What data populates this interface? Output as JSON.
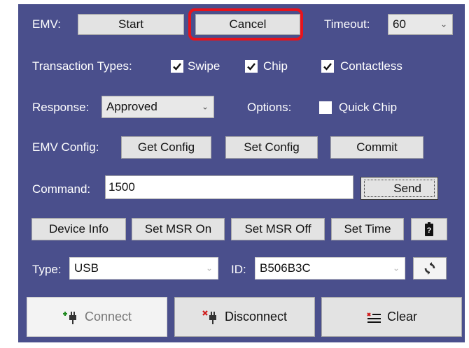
{
  "emv": {
    "label": "EMV:",
    "start_label": "Start",
    "cancel_label": "Cancel",
    "timeout_label": "Timeout:",
    "timeout_value": "60"
  },
  "transaction": {
    "label": "Transaction Types:",
    "types": [
      {
        "label": "Swipe",
        "checked": true
      },
      {
        "label": "Chip",
        "checked": true
      },
      {
        "label": "Contactless",
        "checked": true
      }
    ]
  },
  "response": {
    "label": "Response:",
    "value": "Approved",
    "options_label": "Options:",
    "quick_chip_label": "Quick Chip",
    "quick_chip_checked": false
  },
  "emv_config": {
    "label": "EMV Config:",
    "get_label": "Get Config",
    "set_label": "Set Config",
    "commit_label": "Commit"
  },
  "command": {
    "label": "Command:",
    "value": "1500",
    "send_label": "Send"
  },
  "device_buttons": {
    "device_info_label": "Device Info",
    "msr_on_label": "Set MSR On",
    "msr_off_label": "Set MSR Off",
    "set_time_label": "Set Time"
  },
  "connection": {
    "type_label": "Type:",
    "type_value": "USB",
    "id_label": "ID:",
    "id_value": "B506B3C"
  },
  "actions": {
    "connect_label": "Connect",
    "disconnect_label": "Disconnect",
    "clear_label": "Clear"
  },
  "colors": {
    "panel": "#4a4f8c",
    "highlight": "#e8131b",
    "button": "#e3e3e3"
  }
}
